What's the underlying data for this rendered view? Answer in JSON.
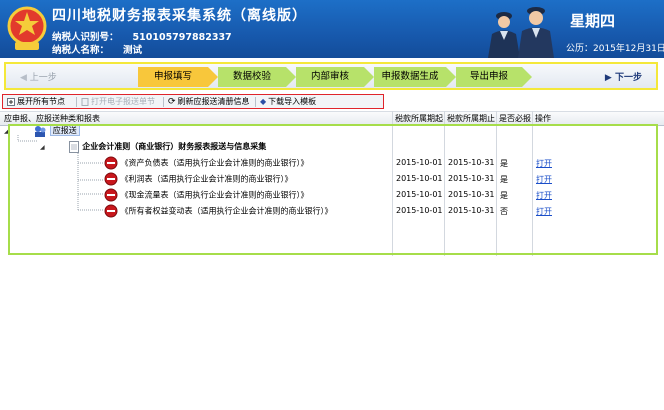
{
  "header": {
    "title": "四川地税财务报表采集系统（离线版）",
    "taxpayer_id_label": "纳税人识别号：",
    "taxpayer_id": "510105797882337",
    "taxpayer_name_label": "纳税人名称：",
    "taxpayer_name": "测试",
    "weekday": "星期四",
    "date": "公历：2015年12月31日"
  },
  "steps": {
    "prev": "上一步",
    "next": "下一步",
    "items": [
      "申报填写",
      "数据校验",
      "内部审核",
      "申报数据生成",
      "导出申报"
    ]
  },
  "toolbar": {
    "expand_all": "展开所有节点",
    "open_report": "打开电子报送单节",
    "refresh": "刷新应报送清册信息",
    "download": "下载导入模板"
  },
  "grid": {
    "headers": [
      "应申报、应报送种类和报表",
      "税款所属期起",
      "税款所属期止",
      "是否必报",
      "操作"
    ],
    "root": "应报送",
    "group": "企业会计准则（商业银行）财务报表报送与信息采集",
    "rows": [
      {
        "name": "《资产负债表（适用执行企业会计准则的商业银行）》",
        "start": "2015-10-01",
        "end": "2015-10-31",
        "required": "是",
        "action": "打开"
      },
      {
        "name": "《利润表（适用执行企业会计准则的商业银行）》",
        "start": "2015-10-01",
        "end": "2015-10-31",
        "required": "是",
        "action": "打开"
      },
      {
        "name": "《现金流量表（适用执行企业会计准则的商业银行）》",
        "start": "2015-10-01",
        "end": "2015-10-31",
        "required": "是",
        "action": "打开"
      },
      {
        "name": "《所有者权益变动表（适用执行企业会计准则的商业银行）》",
        "start": "2015-10-01",
        "end": "2015-10-31",
        "required": "否",
        "action": "打开"
      }
    ]
  },
  "colors": {
    "header_blue": "#1759ad",
    "step_active": "#f8c73b",
    "step_normal": "#b7e26a",
    "highlight_yellow": "#f4e83a",
    "highlight_red": "#e0242b",
    "highlight_green": "#a6dd4a",
    "link_blue": "#1a4ec9"
  }
}
